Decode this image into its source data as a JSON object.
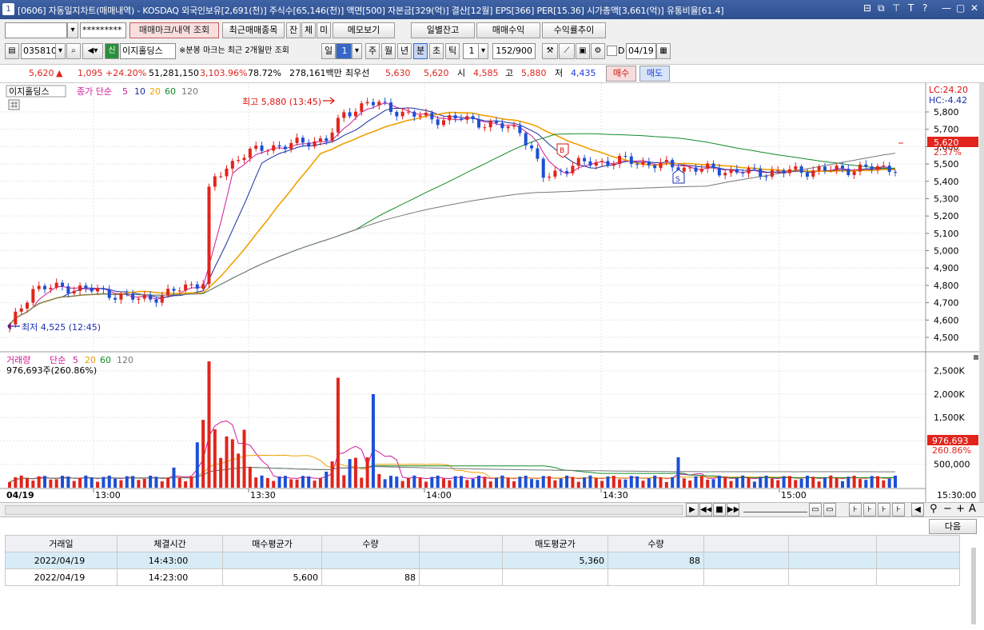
{
  "titlebar": {
    "number": "1",
    "title": "[0606] 자동일지차트(매매내역) - KOSDAQ 외국인보유[2,691(천)] 주식수[65,146(천)] 액면[500] 자본금[329(억)] 결산[12월] EPS[366] PER[15.36] 시가총액[3,661(억)] 유통비율[61.4]",
    "controls": [
      "⊟",
      "⧉",
      "⊤",
      "T",
      "?",
      "—",
      "▢",
      "✕"
    ]
  },
  "toolbar1": {
    "account_value": "",
    "password_value": "*********",
    "trade_mark_btn": "매매마크/내역 조회",
    "recent_btn": "최근매매종목",
    "jan_btn": "잔",
    "che_btn": "체",
    "mi_btn": "미",
    "memo_btn": "메모보기",
    "daily_balance_btn": "일별잔고",
    "trade_profit_btn": "매매수익",
    "yield_trend_btn": "수익률추이"
  },
  "toolbar2": {
    "code": "035810",
    "sin": "신",
    "stock_name": "이지홀딩스",
    "notice": "※분봉 마크는 최근 2개월만 조회",
    "period_day": "일",
    "period_num": "1",
    "period_week": "주",
    "period_month": "월",
    "period_year": "년",
    "period_min": "분",
    "period_sec": "초",
    "period_tick": "틱",
    "interval": "1",
    "count": "152/900",
    "d_label": "D",
    "date": "04/19"
  },
  "quote": {
    "price": "5,620",
    "change_arrow": "▲",
    "change": "1,095",
    "change_pct": "+24.20%",
    "volume": "51,281,150",
    "volume_ratio": "3,103.96%",
    "turnover": "78.72%",
    "amount": "278,161백만",
    "best_label": "최우선",
    "best_ask": "5,630",
    "best_bid": "5,620",
    "open_label": "시",
    "open": "4,585",
    "high_label": "고",
    "high": "5,880",
    "low_label": "저",
    "low": "4,435",
    "buy_btn": "매수",
    "sell_btn": "매도"
  },
  "price_panel": {
    "name": "이지홀딩스",
    "ma_label": "종가 단순",
    "ma_periods": [
      "5",
      "10",
      "20",
      "60",
      "120"
    ],
    "high_note": "최고 5,880 (13:45)",
    "low_note": "최저 4,525 (12:45)",
    "lc": "LC:24.20",
    "hc": "HC:-4.42",
    "current_price_tag": "5,620",
    "current_pct_tag": "2.37%",
    "y_ticks": [
      "5,800",
      "5,700",
      "5,600",
      "5,500",
      "5,400",
      "5,300",
      "5,200",
      "5,100",
      "5,000",
      "4,900",
      "4,800",
      "4,700",
      "4,600",
      "4,500"
    ],
    "marker_b": "B",
    "marker_s": "S"
  },
  "volume_panel": {
    "name": "거래량",
    "ma_label": "단순",
    "ma_periods": [
      "5",
      "20",
      "60",
      "120"
    ],
    "current": "976,693주(260.86%)",
    "current_tag": "976,693",
    "current_pct_tag": "260.86%",
    "y_ticks": [
      "2,500K",
      "2,000K",
      "1,500K",
      "1,000K",
      "500,000"
    ]
  },
  "x_axis": {
    "date": "04/19",
    "ticks": [
      "13:00",
      "13:30",
      "14:00",
      "14:30",
      "15:00",
      "15:30:00"
    ]
  },
  "next_btn": "다음",
  "trade_table": {
    "headers": [
      "거래일",
      "체결시간",
      "매수평균가",
      "수량",
      "",
      "매도평균가",
      "수량",
      "",
      "",
      ""
    ],
    "rows": [
      [
        "2022/04/19",
        "14:43:00",
        "",
        "",
        "",
        "5,360",
        "88",
        "",
        "",
        ""
      ],
      [
        "2022/04/19",
        "14:23:00",
        "5,600",
        "88",
        "",
        "",
        "",
        "",
        "",
        ""
      ]
    ]
  },
  "chart_data": {
    "type": "candlestick",
    "series": [
      {
        "name": "이지홀딩스",
        "kind": "candles"
      },
      {
        "name": "5",
        "color": "#d0199b"
      },
      {
        "name": "10",
        "color": "#1b2fa0"
      },
      {
        "name": "20",
        "color": "#f0a000"
      },
      {
        "name": "60",
        "color": "#138a2c"
      },
      {
        "name": "120",
        "color": "#777777"
      }
    ],
    "y_range": [
      4450,
      5880
    ],
    "volume_range": [
      0,
      2700000
    ],
    "x_range": [
      "12:45",
      "15:30:00"
    ]
  },
  "colors": {
    "up": "#e1241c",
    "down": "#1c4fd6",
    "title": "#2d4f90"
  }
}
